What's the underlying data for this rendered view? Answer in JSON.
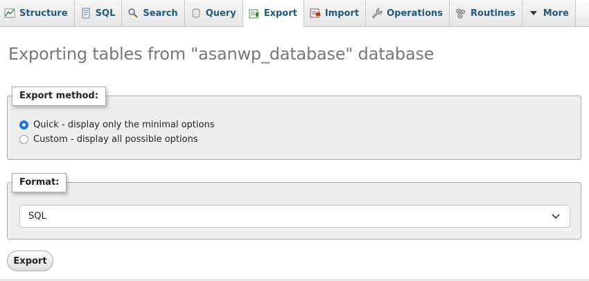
{
  "tabs": [
    {
      "label": "Structure",
      "icon": "structure-icon"
    },
    {
      "label": "SQL",
      "icon": "sql-icon"
    },
    {
      "label": "Search",
      "icon": "search-icon"
    },
    {
      "label": "Query",
      "icon": "query-icon"
    },
    {
      "label": "Export",
      "icon": "export-icon",
      "active": true
    },
    {
      "label": "Import",
      "icon": "import-icon"
    },
    {
      "label": "Operations",
      "icon": "wrench-icon"
    },
    {
      "label": "Routines",
      "icon": "routines-icon"
    },
    {
      "label": "More",
      "icon": "caret-down-icon"
    }
  ],
  "page": {
    "title": "Exporting tables from \"asanwp_database\" database"
  },
  "export_method": {
    "legend": "Export method:",
    "options": [
      {
        "label": "Quick - display only the minimal options",
        "checked": true
      },
      {
        "label": "Custom - display all possible options",
        "checked": false
      }
    ]
  },
  "format": {
    "legend": "Format:",
    "selected": "SQL"
  },
  "actions": {
    "export_label": "Export"
  },
  "colors": {
    "tab_text": "#235a81",
    "title": "#777777",
    "panel_bg": "#eeeeee",
    "radio_accent": "#1a73e8"
  }
}
